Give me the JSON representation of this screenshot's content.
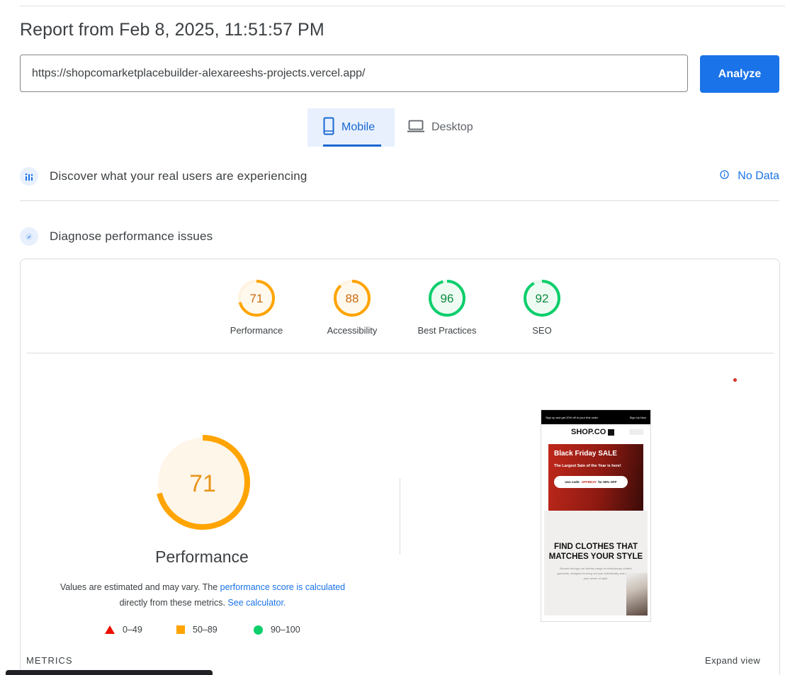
{
  "report": {
    "title": "Report from Feb 8, 2025, 11:51:57 PM",
    "url_value": "https://shopcomarketplacebuilder-alexareeshs-projects.vercel.app/",
    "analyze_label": "Analyze"
  },
  "device_tabs": {
    "mobile_label": "Mobile",
    "desktop_label": "Desktop",
    "selected": "Mobile"
  },
  "field_data": {
    "label": "Discover what your real users are experiencing",
    "status": "No Data"
  },
  "lab_data": {
    "label": "Diagnose performance issues"
  },
  "scores": [
    {
      "label": "Performance",
      "value": "71",
      "color": "#ffa400"
    },
    {
      "label": "Accessibility",
      "value": "88",
      "color": "#ffa400"
    },
    {
      "label": "Best Practices",
      "value": "96",
      "color": "#0cce6b"
    },
    {
      "label": "SEO",
      "value": "92",
      "color": "#0cce6b"
    }
  ],
  "performance": {
    "score": "71",
    "title": "Performance",
    "desc_1": "Values are estimated and may vary. The ",
    "desc_link_1": "performance score is calculated",
    "desc_2": "directly from these metrics. ",
    "desc_link_2": "See calculator."
  },
  "legend": {
    "fail": "0–49",
    "average": "50–89",
    "pass": "90–100"
  },
  "footer": {
    "metrics_label": "METRICS",
    "expand_label": "Expand view"
  },
  "screenshot": {
    "topbar_text": "Sign up and get 20% off to your first order.",
    "topbar_right": "Sign Up Now",
    "brand": "SHOP.CO",
    "banner_title": "Black Friday SALE",
    "banner_sub": "The Largest Sale of the Year is here!",
    "pill_prefix": "Use code:",
    "pill_code": "OFFBDAY",
    "pill_suffix": "for 50% OFF",
    "hero_title": "FIND CLOTHES THAT MATCHES YOUR STYLE",
    "hero_body": "Browse through our diverse range of meticulously crafted garments, designed to bring out your individuality and cater to your sense of style."
  },
  "colors": {
    "accent": "#1a73e8",
    "average": "#ffa400",
    "pass": "#0cce6b",
    "fail": "#eb0f00"
  }
}
